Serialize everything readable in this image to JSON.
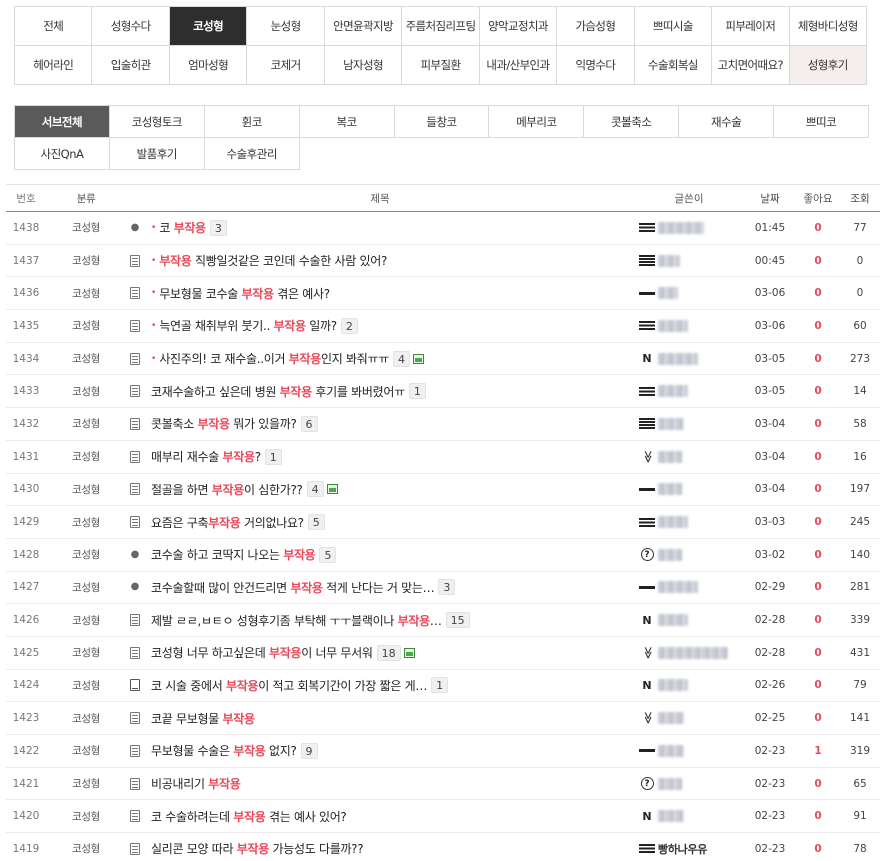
{
  "categories": {
    "row1": [
      "전체",
      "성형수다",
      "코성형",
      "눈성형",
      "안면윤곽지방",
      "주름처짐리프팅",
      "양악교정치과",
      "가슴성형",
      "쁘띠시술",
      "피부레이저",
      "체형바디성형"
    ],
    "row2": [
      "헤어라인",
      "입술히관",
      "엄마성형",
      "코제거",
      "남자성형",
      "피부질환",
      "내과/산부인과",
      "익명수다",
      "수술회복실",
      "고치면어때요?",
      "성형후기"
    ],
    "active": "코성형"
  },
  "subtabs": {
    "row1": [
      "서브전체",
      "코성형토크",
      "휜코",
      "복코",
      "들창코",
      "메부리코",
      "콧볼축소",
      "재수술",
      "쁘띠코"
    ],
    "row2": [
      "사진QnA",
      "발품후기",
      "수술후관리"
    ],
    "active": "서브전체"
  },
  "table": {
    "headers": {
      "num": "번호",
      "category": "분류",
      "title": "제목",
      "writer": "글쓴이",
      "date": "날짜",
      "likes": "좋아요",
      "views": "조회"
    },
    "highlight": "부작용",
    "rows": [
      {
        "num": "1438",
        "category": "코성형",
        "icon": "apple-icon",
        "new": true,
        "pre": "코 ",
        "post": "",
        "comments": "3",
        "image": false,
        "level": "bars3",
        "writer": "",
        "blur_w": 46,
        "date": "01:45",
        "likes": "0",
        "views": "77"
      },
      {
        "num": "1437",
        "category": "코성형",
        "icon": "note-icon",
        "new": true,
        "pre": "",
        "post": " 직빵일것같은 코인데 수술한 사람 있어?",
        "comments": "",
        "image": false,
        "level": "bars4",
        "writer": "",
        "blur_w": 22,
        "date": "00:45",
        "likes": "0",
        "views": "0"
      },
      {
        "num": "1436",
        "category": "코성형",
        "icon": "note-icon",
        "new": true,
        "pre": "무보형물 코수술 ",
        "post": " 겪은 예사?",
        "comments": "",
        "image": false,
        "level": "bar1",
        "writer": "",
        "blur_w": 20,
        "date": "03-06",
        "likes": "0",
        "views": "0"
      },
      {
        "num": "1435",
        "category": "코성형",
        "icon": "note-icon",
        "new": true,
        "pre": "늑연골 채취부위 붓기.. ",
        "post": " 일까?",
        "comments": "2",
        "image": false,
        "level": "bars3",
        "writer": "",
        "blur_w": 30,
        "date": "03-06",
        "likes": "0",
        "views": "60"
      },
      {
        "num": "1434",
        "category": "코성형",
        "icon": "note-icon",
        "new": true,
        "pre": "사진주의! 코 재수술..이거 ",
        "post": "인지 봐줘ㅠㅠ",
        "comments": "4",
        "image": true,
        "level": "N",
        "writer": "",
        "blur_w": 40,
        "date": "03-05",
        "likes": "0",
        "views": "273"
      },
      {
        "num": "1433",
        "category": "코성형",
        "icon": "note-icon",
        "new": false,
        "pre": "코재수술하고 싶은데 병원 ",
        "post": " 후기를 봐버렸어ㅠ",
        "comments": "1",
        "image": false,
        "level": "bars3",
        "writer": "",
        "blur_w": 30,
        "date": "03-05",
        "likes": "0",
        "views": "14"
      },
      {
        "num": "1432",
        "category": "코성형",
        "icon": "note-icon",
        "new": false,
        "pre": "콧볼축소 ",
        "post": " 뭐가 있을까?",
        "comments": "6",
        "image": false,
        "level": "bars4",
        "writer": "",
        "blur_w": 26,
        "date": "03-04",
        "likes": "0",
        "views": "58"
      },
      {
        "num": "1431",
        "category": "코성형",
        "icon": "note-icon",
        "new": false,
        "pre": "매부리 재수술 ",
        "post": "?",
        "comments": "1",
        "image": false,
        "level": "chev",
        "writer": "",
        "blur_w": 24,
        "date": "03-04",
        "likes": "0",
        "views": "16"
      },
      {
        "num": "1430",
        "category": "코성형",
        "icon": "note-icon",
        "new": false,
        "pre": "절골을 하면 ",
        "post": "이 심한가??",
        "comments": "4",
        "image": true,
        "level": "bar1",
        "writer": "",
        "blur_w": 24,
        "date": "03-04",
        "likes": "0",
        "views": "197"
      },
      {
        "num": "1429",
        "category": "코성형",
        "icon": "note-icon",
        "new": false,
        "pre": "요즘은 구축",
        "post": " 거의없나요?",
        "comments": "5",
        "image": false,
        "level": "bars3",
        "writer": "",
        "blur_w": 30,
        "date": "03-03",
        "likes": "0",
        "views": "245"
      },
      {
        "num": "1428",
        "category": "코성형",
        "icon": "apple-icon",
        "new": false,
        "pre": "코수술 하고 코딱지 나오는 ",
        "post": "",
        "comments": "5",
        "image": false,
        "level": "q",
        "writer": "",
        "blur_w": 24,
        "date": "03-02",
        "likes": "0",
        "views": "140"
      },
      {
        "num": "1427",
        "category": "코성형",
        "icon": "apple-icon",
        "new": false,
        "pre": "코수술할때 많이 안건드리면 ",
        "post": " 적게 난다는 거 맞는…",
        "comments": "3",
        "image": false,
        "level": "bar1",
        "writer": "",
        "blur_w": 40,
        "date": "02-29",
        "likes": "0",
        "views": "281"
      },
      {
        "num": "1426",
        "category": "코성형",
        "icon": "note-icon",
        "new": false,
        "pre": "제발 ㄹㄹ,ㅂㅌㅇ 성형후기좀 부탁해 ㅜㅜ블랙이나 ",
        "post": "…",
        "comments": "15",
        "image": false,
        "level": "N",
        "writer": "",
        "blur_w": 30,
        "date": "02-28",
        "likes": "0",
        "views": "339"
      },
      {
        "num": "1425",
        "category": "코성형",
        "icon": "note-icon",
        "new": false,
        "pre": "코성형 너무 하고싶은데 ",
        "post": "이 너무 무서워",
        "comments": "18",
        "image": true,
        "level": "chev",
        "writer": "",
        "blur_w": 70,
        "date": "02-28",
        "likes": "0",
        "views": "431"
      },
      {
        "num": "1424",
        "category": "코성형",
        "icon": "doc-icon",
        "new": false,
        "pre": "코 시술 중에서 ",
        "post": "이 적고 회복기간이 가장 짧은 게…",
        "comments": "1",
        "image": false,
        "level": "N",
        "writer": "",
        "blur_w": 30,
        "date": "02-26",
        "likes": "0",
        "views": "79"
      },
      {
        "num": "1423",
        "category": "코성형",
        "icon": "note-icon",
        "new": false,
        "pre": "코끝 무보형물 ",
        "post": "",
        "comments": "",
        "image": false,
        "level": "chev",
        "writer": "",
        "blur_w": 26,
        "date": "02-25",
        "likes": "0",
        "views": "141"
      },
      {
        "num": "1422",
        "category": "코성형",
        "icon": "note-icon",
        "new": false,
        "pre": "무보형물 수술은 ",
        "post": " 없지?",
        "comments": "9",
        "image": false,
        "level": "bar1",
        "writer": "",
        "blur_w": 26,
        "date": "02-23",
        "likes": "1",
        "views": "319"
      },
      {
        "num": "1421",
        "category": "코성형",
        "icon": "note-icon",
        "new": false,
        "pre": "비공내리기 ",
        "post": "",
        "comments": "",
        "image": false,
        "level": "q",
        "writer": "",
        "blur_w": 24,
        "date": "02-23",
        "likes": "0",
        "views": "65"
      },
      {
        "num": "1420",
        "category": "코성형",
        "icon": "note-icon",
        "new": false,
        "pre": "코 수술하려는데 ",
        "post": " 겪는 예사 있어?",
        "comments": "",
        "image": false,
        "level": "N",
        "writer": "",
        "blur_w": 26,
        "date": "02-23",
        "likes": "0",
        "views": "91"
      },
      {
        "num": "1419",
        "category": "코성형",
        "icon": "note-icon",
        "new": false,
        "pre": "실리콘 모양 따라 ",
        "post": " 가능성도 다를까??",
        "comments": "",
        "image": false,
        "level": "bars3",
        "writer": "빵하나우유",
        "blur_w": 0,
        "date": "02-23",
        "likes": "0",
        "views": "78"
      }
    ]
  },
  "colors": {
    "accent": "#e8495a",
    "active_tab": "#2e2e2e",
    "active_sub": "#5a5a5a"
  }
}
